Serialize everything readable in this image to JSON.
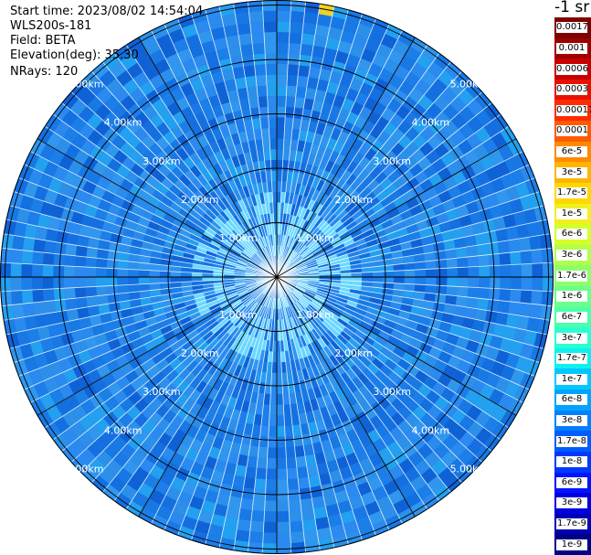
{
  "header": {
    "start_time": "Start time: 2023/08/02 14:54:04",
    "device": "WLS200s-181",
    "field": "Field: BETA",
    "elevation": "Elevation(deg): 35.30",
    "nrays": "NRays: 120"
  },
  "unit_label": "-1 sr",
  "range_rings": {
    "labels": [
      "1.00km",
      "2.00km",
      "3.00km",
      "4.00km",
      "5.00km"
    ]
  },
  "colorbar": {
    "labels": [
      "0.0017",
      "0.001",
      "0.0006",
      "0.0003",
      "0.00017",
      "0.0001",
      "6e-5",
      "3e-5",
      "1.7e-5",
      "1e-5",
      "6e-6",
      "3e-6",
      "1.7e-6",
      "1e-6",
      "6e-7",
      "3e-7",
      "1.7e-7",
      "1e-7",
      "6e-8",
      "3e-8",
      "1.7e-8",
      "1e-8",
      "6e-9",
      "3e-9",
      "1.7e-9",
      "1e-9"
    ],
    "colors": [
      "#7f0000",
      "#a00000",
      "#c80000",
      "#e81000",
      "#ff2a00",
      "#ff5a00",
      "#ff8a00",
      "#ffb400",
      "#ffd800",
      "#f0f020",
      "#d4ff2a",
      "#b0ff4a",
      "#8cff6a",
      "#6aff8a",
      "#4affac",
      "#2affd0",
      "#10f0f0",
      "#00c8ff",
      "#00a4ff",
      "#0080ff",
      "#005cff",
      "#0038ff",
      "#0014ff",
      "#0000e0",
      "#0000b4",
      "#000088"
    ]
  },
  "colors": {
    "background": "#ffffff",
    "field_base": "#1c7ee8",
    "gap_line": "#ffffff",
    "ring_line": "#000000"
  }
}
